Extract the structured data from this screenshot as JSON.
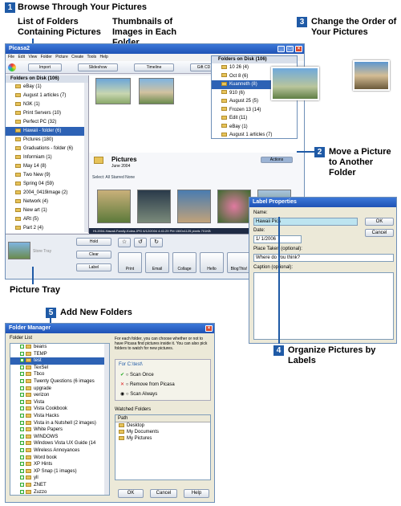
{
  "callouts": {
    "c1": {
      "num": "1",
      "title": "Browse Through Your Pictures"
    },
    "c1a": "List of Folders Containing Pictures",
    "c1b": "Thumbnails of Images in Each Folder",
    "c2": {
      "num": "2",
      "title": "Move a Picture to Another Folder"
    },
    "c3": {
      "num": "3",
      "title": "Change the Order of Your Pictures"
    },
    "c4": {
      "num": "4",
      "title": "Organize Pictures by Labels"
    },
    "c5": {
      "num": "5",
      "title": "Add New Folders"
    },
    "tray": "Picture Tray"
  },
  "picasa": {
    "title": "Picasa2",
    "menu": [
      "File",
      "Edit",
      "View",
      "Folder",
      "Picture",
      "Create",
      "Tools",
      "Help"
    ],
    "toolbar": [
      "Import",
      "Slideshow",
      "Timeline",
      "Gift CD"
    ],
    "folders_header": "Folders on Disk (106)",
    "folders": [
      "eBay (1)",
      "August 1 articles (7)",
      "N3K (1)",
      "Print Servers (10)",
      "Perfect PC (32)",
      "Hawaii - folder (6)",
      "Pictures (180)",
      "Graduations - folder (6)",
      "Informiam (1)",
      "May 14 (8)",
      "Two New (9)",
      "Spring 04 (59)",
      "2004_0419image (2)",
      "Network (4)",
      "New art (1)",
      "ARt (5)",
      "Part 2 (4)"
    ],
    "selected_folder": "Hawaii - folder (6)",
    "album_title": "Pictures",
    "album_date": "June 2004",
    "select_bar": "Select:  All  Starred  None",
    "actions": "Actions",
    "status": "HI-2004-Hawaii-Family-Kolea.JPG    6/12/2004 4:41:29 PM    1500x1125 pixels    701KB",
    "tray_label": "Store Tray",
    "tray_btns": [
      "Hold",
      "Clear",
      "Label"
    ],
    "action_btns": [
      "Print",
      "Email",
      "Collage",
      "Hello",
      "BlogThis!"
    ]
  },
  "disk_panel": {
    "header": "Folders on Disk (106)",
    "items": [
      "10 26 (4)",
      "Oct 8 (6)",
      "Kuanneth (8)",
      "910 (6)",
      "August 25 (5)",
      "Frozen 13 (14)",
      "Edit (11)",
      "eBay (1)",
      "August 1 articles (7)"
    ],
    "selected": "Kuanneth (8)"
  },
  "label_dialog": {
    "title": "Label Properties",
    "name_label": "Name:",
    "name_value": "Hawaii Pics",
    "date_label": "Date:",
    "date_value": "1/ 1/2006",
    "place_label": "Place Taken (optional):",
    "place_value": "Where do you think?",
    "caption_label": "Caption (optional):",
    "ok": "OK",
    "cancel": "Cancel"
  },
  "folder_manager": {
    "title": "Folder Manager",
    "list_label": "Folder List",
    "folders": [
      "beans",
      "TEMP",
      "test",
      "TexSel",
      "Tbco",
      "Twenty Questions (6 images",
      "upgrade",
      "verizon",
      "Vista",
      "Vista Cookbook",
      "Vista Hacks",
      "Vista in a Nutshell (2 images)",
      "White Papers",
      "WINDOWS",
      "Windows Vista UX Guide (14",
      "Wireless Annoyances",
      "Word book",
      "XP Hints",
      "XP Snap (1 images)",
      "yll",
      "ZNET",
      "Zuzzo"
    ],
    "selected": "test",
    "info": "For each folder, you can choose whether or not to have Picasa find pictures inside it. You can also pick folders to watch for new pictures.",
    "path_label": "For C:\\test\\",
    "options": [
      "Scan Once",
      "Remove from Picasa",
      "Scan Always"
    ],
    "watched_label": "Watched Folders",
    "path_header": "Path",
    "watched": [
      "Desktop",
      "My Documents",
      "My Pictures"
    ],
    "ok": "OK",
    "cancel": "Cancel",
    "help": "Help"
  }
}
